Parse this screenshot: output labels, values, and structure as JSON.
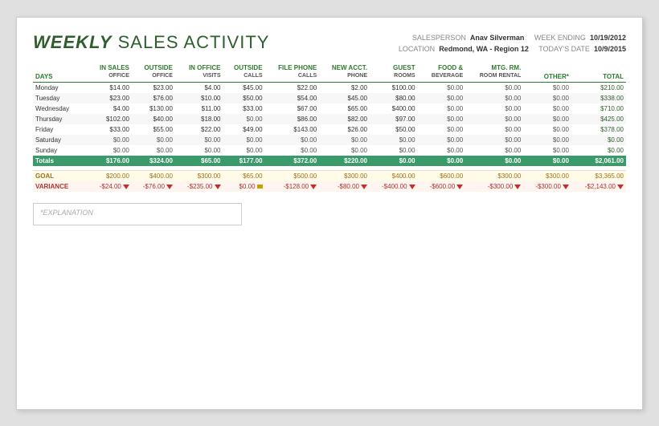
{
  "title": {
    "bold": "WEEKLY",
    "rest": " SALES ACTIVITY"
  },
  "meta": {
    "salesperson_label": "SALESPERSON",
    "salesperson_value": "Anav Silverman",
    "week_ending_label": "WEEK ENDING",
    "week_ending_value": "10/19/2012",
    "location_label": "LOCATION",
    "location_value": "Redmond, WA - Region 12",
    "todays_date_label": "TODAY'S DATE",
    "todays_date_value": "10/9/2015"
  },
  "columns": [
    {
      "id": "days",
      "label": "DAYS",
      "sub": ""
    },
    {
      "id": "in_sales",
      "label": "IN SALES",
      "sub": "OFFICE"
    },
    {
      "id": "outside",
      "label": "OUTSIDE",
      "sub": "OFFICE"
    },
    {
      "id": "in_office",
      "label": "IN OFFICE",
      "sub": "VISITS"
    },
    {
      "id": "outside_calls",
      "label": "OUTSIDE",
      "sub": "CALLS"
    },
    {
      "id": "file_phone",
      "label": "FILE PHONE",
      "sub": "CALLS"
    },
    {
      "id": "new_acct",
      "label": "NEW ACCT.",
      "sub": "PHONE"
    },
    {
      "id": "guest_rooms",
      "label": "GUEST",
      "sub": "ROOMS"
    },
    {
      "id": "food_bev",
      "label": "FOOD &",
      "sub": "BEVERAGE"
    },
    {
      "id": "room_rental",
      "label": "MTG. RM.",
      "sub": "ROOM RENTAL"
    },
    {
      "id": "other",
      "label": "OTHER*",
      "sub": ""
    },
    {
      "id": "total",
      "label": "TOTAL",
      "sub": ""
    }
  ],
  "rows": [
    {
      "day": "Monday",
      "in_sales": "$14.00",
      "outside": "$23.00",
      "in_office": "$4.00",
      "outside_calls": "$45.00",
      "file_phone": "$22.00",
      "new_acct": "$2.00",
      "guest_rooms": "$100.00",
      "food_bev": "$0.00",
      "room_rental": "$0.00",
      "other": "$0.00",
      "total": "$210.00"
    },
    {
      "day": "Tuesday",
      "in_sales": "$23.00",
      "outside": "$76.00",
      "in_office": "$10.00",
      "outside_calls": "$50.00",
      "file_phone": "$54.00",
      "new_acct": "$45.00",
      "guest_rooms": "$80.00",
      "food_bev": "$0.00",
      "room_rental": "$0.00",
      "other": "$0.00",
      "total": "$338.00"
    },
    {
      "day": "Wednesday",
      "in_sales": "$4.00",
      "outside": "$130.00",
      "in_office": "$11.00",
      "outside_calls": "$33.00",
      "file_phone": "$67.00",
      "new_acct": "$65.00",
      "guest_rooms": "$400.00",
      "food_bev": "$0.00",
      "room_rental": "$0.00",
      "other": "$0.00",
      "total": "$710.00"
    },
    {
      "day": "Thursday",
      "in_sales": "$102.00",
      "outside": "$40.00",
      "in_office": "$18.00",
      "outside_calls": "$0.00",
      "file_phone": "$86.00",
      "new_acct": "$82.00",
      "guest_rooms": "$97.00",
      "food_bev": "$0.00",
      "room_rental": "$0.00",
      "other": "$0.00",
      "total": "$425.00"
    },
    {
      "day": "Friday",
      "in_sales": "$33.00",
      "outside": "$55.00",
      "in_office": "$22.00",
      "outside_calls": "$49.00",
      "file_phone": "$143.00",
      "new_acct": "$26.00",
      "guest_rooms": "$50.00",
      "food_bev": "$0.00",
      "room_rental": "$0.00",
      "other": "$0.00",
      "total": "$378.00"
    },
    {
      "day": "Saturday",
      "in_sales": "$0.00",
      "outside": "$0.00",
      "in_office": "$0.00",
      "outside_calls": "$0.00",
      "file_phone": "$0.00",
      "new_acct": "$0.00",
      "guest_rooms": "$0.00",
      "food_bev": "$0.00",
      "room_rental": "$0.00",
      "other": "$0.00",
      "total": "$0.00"
    },
    {
      "day": "Sunday",
      "in_sales": "$0.00",
      "outside": "$0.00",
      "in_office": "$0.00",
      "outside_calls": "$0.00",
      "file_phone": "$0.00",
      "new_acct": "$0.00",
      "guest_rooms": "$0.00",
      "food_bev": "$0.00",
      "room_rental": "$0.00",
      "other": "$0.00",
      "total": "$0.00"
    }
  ],
  "totals": {
    "label": "Totals",
    "in_sales": "$176.00",
    "outside": "$324.00",
    "in_office": "$65.00",
    "outside_calls": "$177.00",
    "file_phone": "$372.00",
    "new_acct": "$220.00",
    "guest_rooms": "$0.00",
    "food_bev": "$0.00",
    "room_rental": "$0.00",
    "other": "$0.00",
    "total": "$2,061.00"
  },
  "goal": {
    "label": "GOAL",
    "in_sales": "$200.00",
    "outside": "$400.00",
    "in_office": "$300.00",
    "outside_calls": "$65.00",
    "file_phone": "$500.00",
    "new_acct": "$300.00",
    "guest_rooms": "$400.00",
    "food_bev": "$600.00",
    "room_rental": "$300.00",
    "other": "$300.00",
    "total": "$3,365.00"
  },
  "variance": {
    "label": "VARIANCE",
    "in_sales": "-$24.00",
    "outside": "-$76.00",
    "in_office": "-$235.00",
    "outside_calls": "$0.00",
    "file_phone": "-$128.00",
    "new_acct": "-$80.00",
    "guest_rooms": "-$400.00",
    "food_bev": "-$600.00",
    "room_rental": "-$300.00",
    "other": "-$300.00",
    "total": "-$2,143.00",
    "neutral_col": "outside_calls"
  },
  "explanation_placeholder": "*EXPLANATION"
}
